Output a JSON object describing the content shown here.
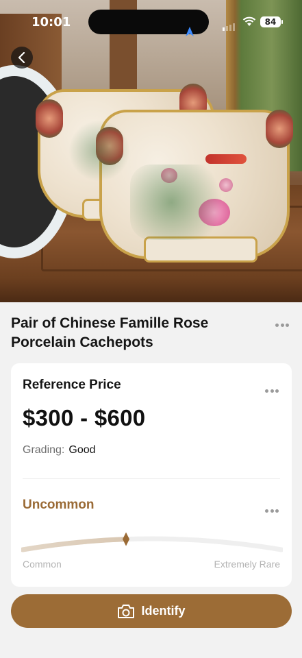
{
  "status_bar": {
    "time": "10:01",
    "battery": "84",
    "icons": [
      "navigation-arrow-icon",
      "cellular-signal-icon",
      "wifi-icon",
      "battery-icon"
    ]
  },
  "header": {
    "back_icon": "chevron-left-icon"
  },
  "photo": {
    "description_icon": "item-photo"
  },
  "item": {
    "title": "Pair of Chinese Famille Rose Porcelain Cachepots",
    "more_icon": "more-dots-icon"
  },
  "price_card": {
    "heading": "Reference Price",
    "price": "$300 - $600",
    "grading_label": "Grading:",
    "grading_value": "Good",
    "rarity_label": "Uncommon",
    "rarity_level": 0.4,
    "scale_min_label": "Common",
    "scale_max_label": "Extremely Rare",
    "accent_color": "#9a6a35"
  },
  "actions": {
    "identify_label": "Identify",
    "identify_icon": "camera-icon",
    "button_color": "#9c6c36"
  }
}
